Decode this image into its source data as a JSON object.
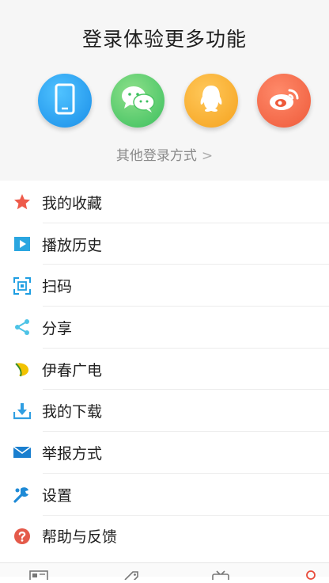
{
  "login": {
    "title": "登录体验更多功能",
    "methods": [
      {
        "name": "phone",
        "icon": "phone-icon",
        "color": "#1a8ee8"
      },
      {
        "name": "wechat",
        "icon": "wechat-icon",
        "color": "#3bbf5e"
      },
      {
        "name": "qq",
        "icon": "qq-icon",
        "color": "#f5a21e"
      },
      {
        "name": "weibo",
        "icon": "weibo-icon",
        "color": "#ee5a3a"
      }
    ],
    "other_label": "其他登录方式",
    "other_chevron": ">"
  },
  "menu": {
    "items": [
      {
        "label": "我的收藏",
        "icon": "star-icon"
      },
      {
        "label": "播放历史",
        "icon": "play-icon"
      },
      {
        "label": "扫码",
        "icon": "scan-icon"
      },
      {
        "label": "分享",
        "icon": "share-icon"
      },
      {
        "label": "伊春广电",
        "icon": "leaf-icon"
      },
      {
        "label": "我的下载",
        "icon": "download-icon"
      },
      {
        "label": "举报方式",
        "icon": "mail-icon"
      },
      {
        "label": "设置",
        "icon": "gear-icon"
      },
      {
        "label": "帮助与反馈",
        "icon": "help-icon"
      }
    ]
  },
  "tabbar": {
    "tabs": [
      {
        "icon": "news-tab-icon"
      },
      {
        "icon": "tag-tab-icon"
      },
      {
        "icon": "tv-tab-icon"
      },
      {
        "icon": "profile-tab-icon",
        "active_color": "#e84a3a"
      }
    ]
  }
}
